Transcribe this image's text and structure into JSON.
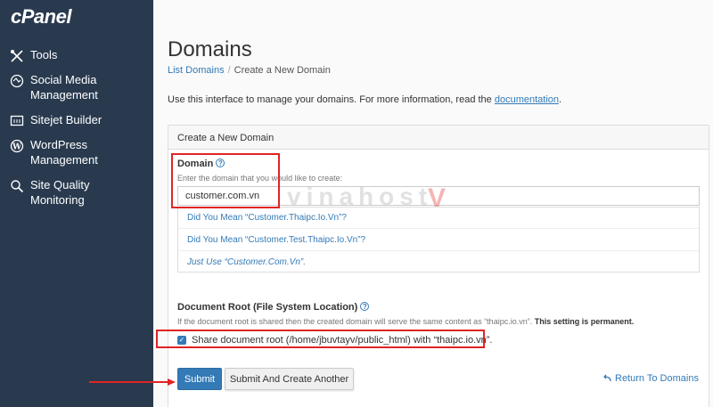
{
  "sidebar": {
    "logo": "cPanel",
    "items": [
      {
        "label": "Tools",
        "icon": "tools-icon"
      },
      {
        "label": "Social Media Management",
        "icon": "social-media-icon"
      },
      {
        "label": "Sitejet Builder",
        "icon": "sitejet-icon"
      },
      {
        "label": "WordPress Management",
        "icon": "wordpress-icon"
      },
      {
        "label": "Site Quality Monitoring",
        "icon": "site-quality-icon"
      }
    ]
  },
  "header": {
    "title": "Domains",
    "breadcrumb": {
      "link": "List Domains",
      "separator": "/",
      "current": "Create a New Domain"
    },
    "intro_text": "Use this interface to manage your domains. For more information, read the ",
    "intro_link": "documentation",
    "intro_end": "."
  },
  "form": {
    "panel_title": "Create a New Domain",
    "domain_label": "Domain",
    "domain_hint": "Enter the domain that you would like to create:",
    "domain_value": "customer.com.vn",
    "suggestions": [
      "Did You Mean “Customer.Thaipc.Io.Vn”?",
      "Did You Mean “Customer.Test.Thaipc.Io.Vn”?",
      "Just Use “Customer.Com.Vn”."
    ],
    "docroot_label": "Document Root (File System Location)",
    "docroot_hint": "If the document root is shared then the created domain will serve the same content as “thaipc.io.vn”. ",
    "docroot_hint_bold": "This setting is permanent.",
    "share_checkbox_label": "Share document root (/home/jbuvtayv/public_html) with “thaipc.io.vn”.",
    "share_checked": true,
    "submit_label": "Submit",
    "submit_another_label": "Submit And Create Another",
    "return_label": "Return To Domains"
  },
  "watermark": {
    "text": "vinahost",
    "mark": "V"
  },
  "colors": {
    "sidebar": "#293a4f",
    "accent": "#337ab7",
    "annotation": "#e02424"
  }
}
